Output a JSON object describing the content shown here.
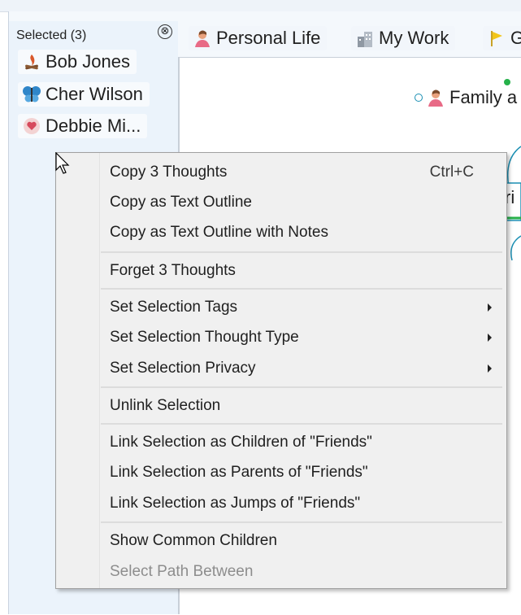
{
  "selection_panel": {
    "title": "Selected (3)",
    "close_glyph": "⊗",
    "items": [
      {
        "label": "Bob Jones",
        "icon": "campfire-icon"
      },
      {
        "label": "Cher Wilson",
        "icon": "butterfly-icon"
      },
      {
        "label": "Debbie Mi...",
        "icon": "heart-icon"
      }
    ]
  },
  "tabs": [
    {
      "label": "Personal Life",
      "icon": "person-icon"
    },
    {
      "label": "My Work",
      "icon": "building-icon"
    },
    {
      "label": "G",
      "icon": "flag-icon"
    }
  ],
  "map": {
    "family_node": "Family a",
    "friends_node_partial": "ri"
  },
  "context_menu": {
    "items": [
      {
        "label": "Copy 3 Thoughts",
        "shortcut": "Ctrl+C"
      },
      {
        "label": "Copy as Text Outline"
      },
      {
        "label": "Copy as Text Outline with Notes"
      },
      {
        "label": "Forget 3 Thoughts"
      },
      {
        "label": "Set Selection Tags",
        "submenu": true
      },
      {
        "label": "Set Selection Thought Type",
        "submenu": true
      },
      {
        "label": "Set Selection Privacy",
        "submenu": true
      },
      {
        "label": "Unlink Selection"
      },
      {
        "label": "Link Selection as Children of \"Friends\""
      },
      {
        "label": "Link Selection as Parents of \"Friends\""
      },
      {
        "label": "Link Selection as Jumps of \"Friends\""
      },
      {
        "label": "Show Common Children"
      },
      {
        "label": "Select Path Between",
        "disabled": true
      }
    ]
  },
  "colors": {
    "panel_bg": "#ebf3fb",
    "menu_bg": "#f0f0f0",
    "disabled_text": "#8d8d8d",
    "node_link": "#1a8fb3"
  }
}
